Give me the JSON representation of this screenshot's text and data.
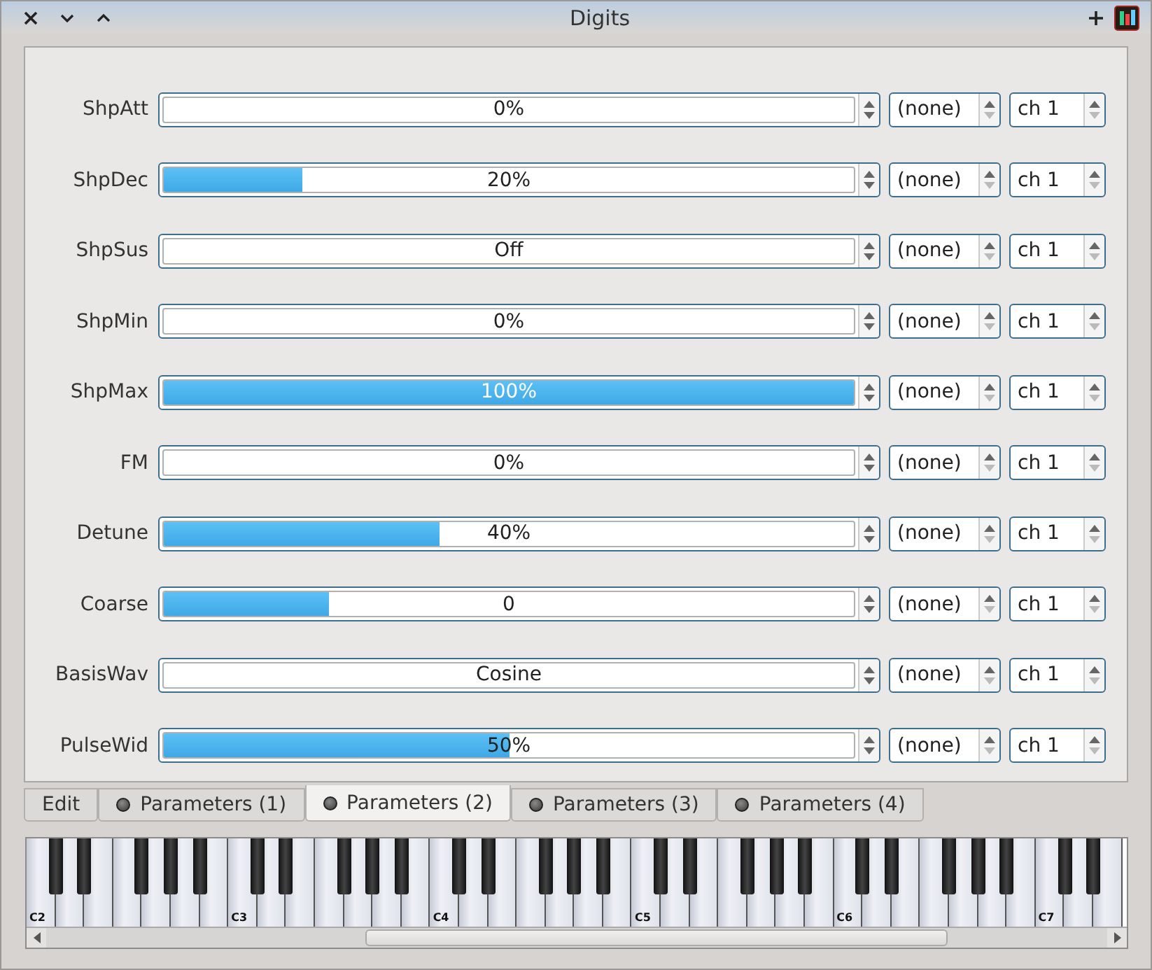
{
  "window": {
    "title": "Digits"
  },
  "params": [
    {
      "name": "ShpAtt",
      "value": "0%",
      "level": 0,
      "source": "(none)",
      "channel": "ch 1"
    },
    {
      "name": "ShpDec",
      "value": "20%",
      "level": 0.2,
      "source": "(none)",
      "channel": "ch 1"
    },
    {
      "name": "ShpSus",
      "value": "Off",
      "level": 0,
      "source": "(none)",
      "channel": "ch 1"
    },
    {
      "name": "ShpMin",
      "value": "0%",
      "level": 0,
      "source": "(none)",
      "channel": "ch 1"
    },
    {
      "name": "ShpMax",
      "value": "100%",
      "level": 1,
      "source": "(none)",
      "channel": "ch 1"
    },
    {
      "name": "FM",
      "value": "0%",
      "level": 0,
      "source": "(none)",
      "channel": "ch 1"
    },
    {
      "name": "Detune",
      "value": "40%",
      "level": 0.4,
      "source": "(none)",
      "channel": "ch 1"
    },
    {
      "name": "Coarse",
      "value": "0",
      "level": 0.24,
      "source": "(none)",
      "channel": "ch 1"
    },
    {
      "name": "BasisWav",
      "value": "Cosine",
      "level": 0,
      "source": "(none)",
      "channel": "ch 1"
    },
    {
      "name": "PulseWid",
      "value": "50%",
      "level": 0.5,
      "source": "(none)",
      "channel": "ch 1"
    }
  ],
  "tabs": [
    {
      "label": "Edit",
      "led": false,
      "selected": false
    },
    {
      "label": "Parameters (1)",
      "led": true,
      "selected": false
    },
    {
      "label": "Parameters (2)",
      "led": true,
      "selected": true
    },
    {
      "label": "Parameters (3)",
      "led": true,
      "selected": false
    },
    {
      "label": "Parameters (4)",
      "led": true,
      "selected": false
    }
  ],
  "keyboard": {
    "octaves": [
      "C2",
      "C3",
      "C4",
      "C5",
      "C6",
      "C7"
    ]
  }
}
